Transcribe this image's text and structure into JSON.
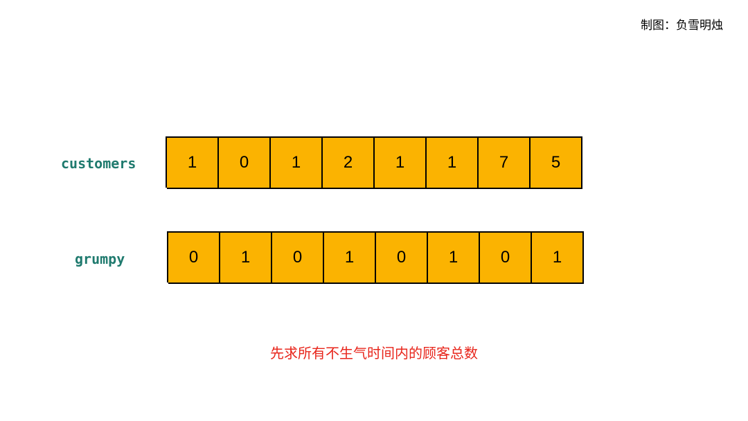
{
  "credit": "制图：负雪明烛",
  "rows": [
    {
      "label": "customers",
      "values": [
        "1",
        "0",
        "1",
        "2",
        "1",
        "1",
        "7",
        "5"
      ]
    },
    {
      "label": "grumpy",
      "values": [
        "0",
        "1",
        "0",
        "1",
        "0",
        "1",
        "0",
        "1"
      ]
    }
  ],
  "caption": "先求所有不生气时间内的顾客总数",
  "colors": {
    "cell_fill": "#fbb301",
    "label": "#1f7a6e",
    "caption": "#e8251b"
  }
}
